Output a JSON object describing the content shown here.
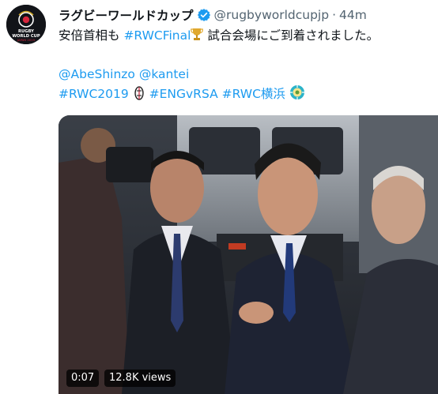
{
  "account": {
    "display_name": "ラグビーワールドカップ",
    "handle": "@rugbyworldcupjp",
    "separator": "·",
    "time": "44m",
    "avatar_text": [
      "RUGBY",
      "WORLD CUP",
      "JAPAN 2019"
    ]
  },
  "tweet": {
    "line1_prefix": "安倍首相も ",
    "line1_hashtag": "#RWCFinal",
    "line1_suffix": " 試合会場にご到着されました。",
    "mention1": "@AbeShinzo",
    "mention2": "@kantei",
    "hashtag1": "#RWC2019",
    "hashtag2": "#ENGvRSA",
    "hashtag3": "#RWC横浜"
  },
  "video": {
    "duration": "0:07",
    "views": "12.8K views"
  },
  "colors": {
    "link": "#1d9bf0",
    "verified": "#1d9bf0",
    "muted": "#536471",
    "text": "#0f1419"
  },
  "icons": [
    "verified-badge-icon",
    "trophy-emoji-icon",
    "rugby-ball-emoji-icon",
    "yokohama-emblem-emoji-icon"
  ]
}
